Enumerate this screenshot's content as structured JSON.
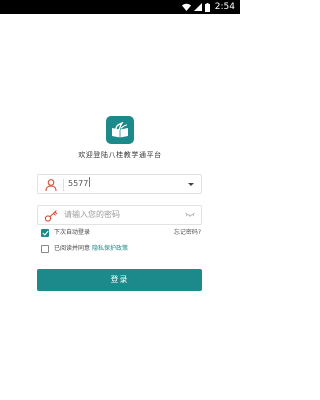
{
  "status_bar": {
    "time": "2:54",
    "icons": [
      "wifi-icon",
      "signal-icon",
      "battery-icon"
    ]
  },
  "app": {
    "logo_icon": "book-logo-icon",
    "title": "欢迎登陆八桂教学通平台",
    "accent_color": "#1c8a8a"
  },
  "login_form": {
    "username": {
      "value": "5577",
      "icon": "user-icon",
      "dropdown_icon": "chevron-down-icon"
    },
    "password": {
      "placeholder": "请输入您的密码",
      "icon": "key-icon",
      "toggle_icon": "eye-closed-icon"
    },
    "auto_login": {
      "label": "下次自动登录",
      "checked": true
    },
    "forgot_password": "忘记密码?",
    "agreement": {
      "label": "已阅读并同意",
      "link": "隐私保护政策",
      "checked": false
    },
    "submit_label": "登录"
  }
}
